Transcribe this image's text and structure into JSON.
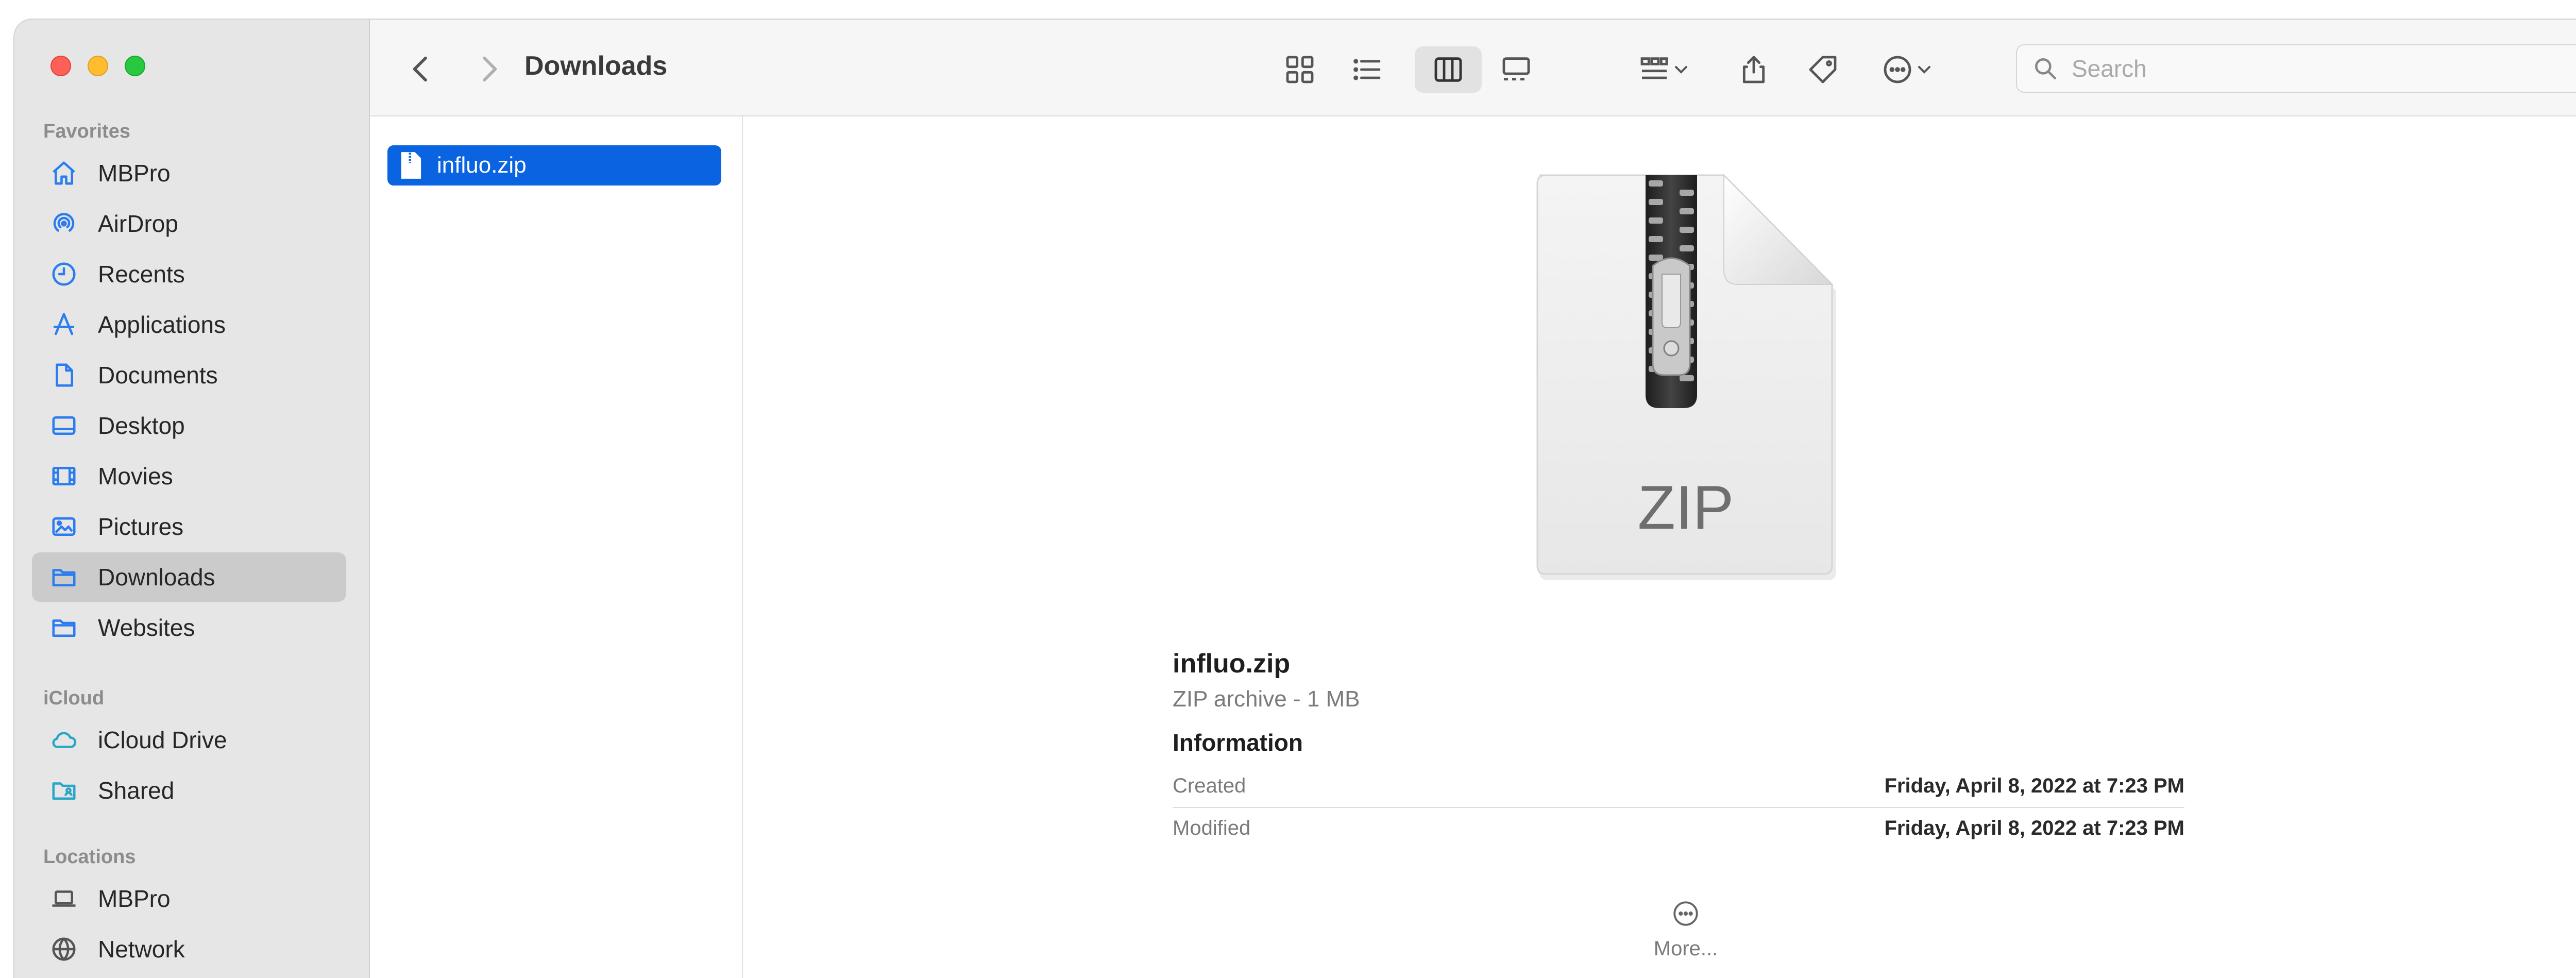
{
  "window": {
    "title": "Downloads"
  },
  "sidebar": {
    "favorites_label": "Favorites",
    "icloud_label": "iCloud",
    "locations_label": "Locations",
    "favorites": [
      {
        "label": "MBPro",
        "icon": "house-icon"
      },
      {
        "label": "AirDrop",
        "icon": "airdrop-icon"
      },
      {
        "label": "Recents",
        "icon": "clock-icon"
      },
      {
        "label": "Applications",
        "icon": "applications-icon"
      },
      {
        "label": "Documents",
        "icon": "document-icon"
      },
      {
        "label": "Desktop",
        "icon": "desktop-icon"
      },
      {
        "label": "Movies",
        "icon": "film-icon"
      },
      {
        "label": "Pictures",
        "icon": "photo-icon"
      },
      {
        "label": "Downloads",
        "icon": "folder-icon",
        "selected": true
      },
      {
        "label": "Websites",
        "icon": "folder-icon"
      }
    ],
    "icloud": [
      {
        "label": "iCloud Drive",
        "icon": "cloud-icon"
      },
      {
        "label": "Shared",
        "icon": "shared-folder-icon"
      }
    ],
    "locations": [
      {
        "label": "MBPro",
        "icon": "laptop-icon"
      },
      {
        "label": "Network",
        "icon": "globe-icon"
      }
    ]
  },
  "toolbar": {
    "search_placeholder": "Search"
  },
  "column": {
    "items": [
      {
        "label": "influo.zip",
        "selected": true
      }
    ]
  },
  "preview": {
    "icon_label": "ZIP",
    "file_name": "influo.zip",
    "file_kind": "ZIP archive - 1 MB",
    "info_heading": "Information",
    "rows": [
      {
        "label": "Created",
        "value": "Friday, April 8, 2022 at 7:23 PM"
      },
      {
        "label": "Modified",
        "value": "Friday, April 8, 2022 at 7:23 PM"
      }
    ],
    "more_label": "More..."
  },
  "colors": {
    "accent": "#0a63e0",
    "sidebar_bg": "#e6e6e6",
    "selection_gray": "#cbcbcb",
    "icon_blue": "#2b7cf0"
  }
}
